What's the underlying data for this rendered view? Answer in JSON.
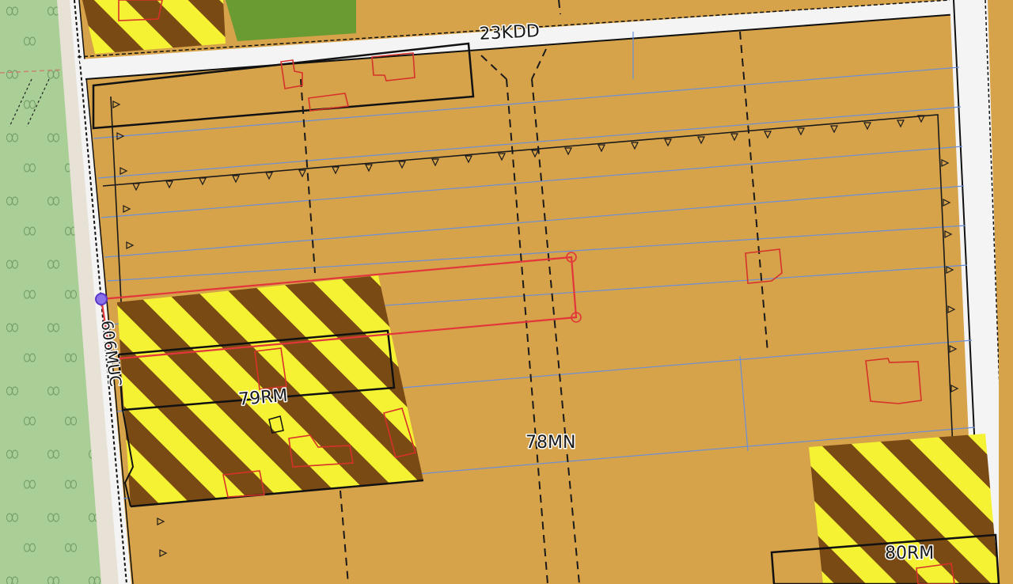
{
  "map": {
    "labels": {
      "street": "23KDD",
      "parcel_center": "78MN",
      "parcel_left": "79RM",
      "parcel_bottom_right": "80RM",
      "vertical": "606MUC"
    },
    "colors": {
      "background": "#d6a24a",
      "forest": "#a9cf97",
      "grass": "#6a9a32",
      "road": "#f4f4f4",
      "road_shoulder": "#e8e2d6",
      "hatch_dark": "#7a4a14",
      "hatch_light": "#f4f232",
      "selection": "#e2363b",
      "vertex_start": "#5a38c8",
      "grid_line": "#6a8fd8"
    },
    "icons": [
      "tree-icon",
      "vertex-handle-icon"
    ]
  }
}
